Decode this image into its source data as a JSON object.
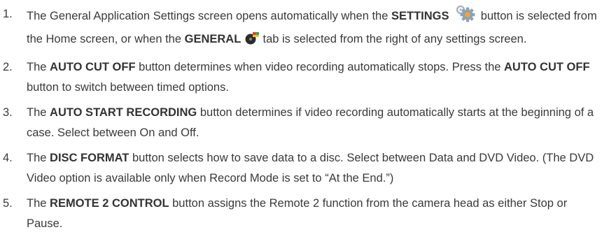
{
  "items": [
    {
      "number": "1.",
      "t1": "The General Application Settings screen opens automatically when the ",
      "b1": "SETTINGS",
      "t2": " button is selected from the Home screen, or when the ",
      "b2": "GENERAL",
      "t3": " tab is selected from the right of any settings screen.",
      "icons": [
        "settings-gear-icon",
        "general-tab-icon"
      ]
    },
    {
      "number": "2.",
      "t1": "The ",
      "b1": "AUTO CUT OFF",
      "t2": " button determines when video recording automatically stops. Press the ",
      "b2": "AUTO CUT OFF",
      "t3": " button to switch between timed options."
    },
    {
      "number": "3.",
      "t1": "The ",
      "b1": "AUTO START RECORDING",
      "t2": " button determines if video recording automatically starts at the beginning of a case. Select between On and Off."
    },
    {
      "number": "4.",
      "t1": "The ",
      "b1": "DISC FORMAT",
      "t2": " button selects how to save data to a disc. Select between Data and DVD Video. (The DVD Video option is available only when Record Mode is set to “At the End.”)"
    },
    {
      "number": "5.",
      "t1": "The ",
      "b1": "REMOTE 2 CONTROL",
      "t2": " button assigns the Remote 2 function from the camera head as either Stop or Pause."
    }
  ],
  "colors": {
    "text": "#3a3a3a",
    "gear": "#8fa3b3",
    "gear_center": "#f2a33a"
  }
}
